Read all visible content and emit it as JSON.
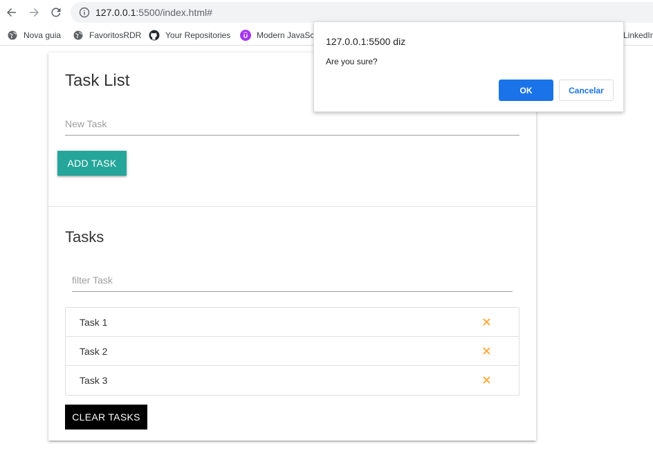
{
  "browser": {
    "url_host": "127.0.0.1",
    "url_rest": ":5500/index.html#",
    "bookmarks": [
      {
        "label": "Nova guia",
        "icon": "globe-icon"
      },
      {
        "label": "FavoritosRDR",
        "icon": "globe-icon"
      },
      {
        "label": "Your Repositories",
        "icon": "github-icon"
      },
      {
        "label": "Modern JavaScr",
        "icon": "udemy-icon"
      },
      {
        "label": "LinkedIn",
        "icon": "linkedin-icon"
      }
    ]
  },
  "card": {
    "title": "Task List",
    "new_task_placeholder": "New Task",
    "add_button": "ADD TASK",
    "tasks_title": "Tasks",
    "filter_placeholder": "filter Task",
    "tasks": [
      "Task 1",
      "Task 2",
      "Task 3"
    ],
    "clear_button": "CLEAR TASKS"
  },
  "dialog": {
    "title": "127.0.0.1:5500 diz",
    "message": "Are you sure?",
    "ok_label": "OK",
    "cancel_label": "Cancelar"
  },
  "colors": {
    "teal": "#26a69a",
    "delete_icon": "#ffab40",
    "dialog_blue": "#1a73e8"
  }
}
